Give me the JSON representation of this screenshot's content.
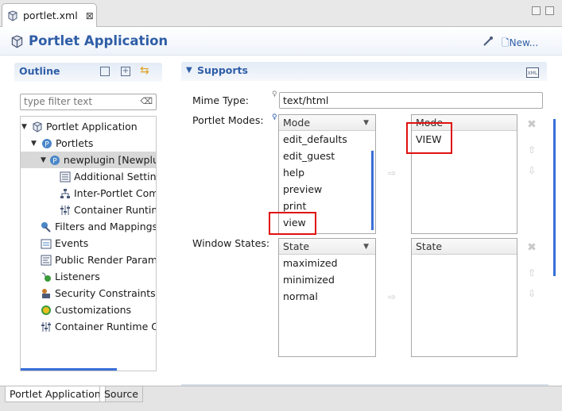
{
  "editor": {
    "tab_label": "portlet.xml",
    "close_glyph": "⊠",
    "form_title": "Portlet Application",
    "new_label": "New..."
  },
  "outline": {
    "title": "Outline",
    "filter_placeholder": "type filter text",
    "items": [
      {
        "label": "Portlet Application",
        "icon": "portlet-app-icon"
      },
      {
        "label": "Portlets",
        "icon": "portlets-icon"
      },
      {
        "label": "newplugin [Newplu",
        "icon": "portlet-icon"
      },
      {
        "label": "Additional Setting",
        "icon": "settings-icon"
      },
      {
        "label": "Inter-Portlet Com",
        "icon": "communication-icon"
      },
      {
        "label": "Container Runtim",
        "icon": "runtime-icon"
      },
      {
        "label": "Filters and Mappings",
        "icon": "filter-icon"
      },
      {
        "label": "Events",
        "icon": "events-icon"
      },
      {
        "label": "Public Render Parame",
        "icon": "render-param-icon"
      },
      {
        "label": "Listeners",
        "icon": "listener-icon"
      },
      {
        "label": "Security Constraints",
        "icon": "security-icon"
      },
      {
        "label": "Customizations",
        "icon": "customization-icon"
      },
      {
        "label": "Container Runtime Op",
        "icon": "runtime-icon"
      }
    ]
  },
  "supports": {
    "title": "Supports",
    "mime_label": "Mime Type:",
    "mime_value": "text/html",
    "modes_label": "Portlet Modes:",
    "modes_header": "Mode",
    "modes_available": [
      "edit_defaults",
      "edit_guest",
      "help",
      "preview",
      "print",
      "view"
    ],
    "modes_selected_header": "Mode",
    "modes_selected": [
      "VIEW"
    ],
    "states_label": "Window States:",
    "states_header": "State",
    "states_available": [
      "maximized",
      "minimized",
      "normal"
    ],
    "states_selected_header": "State",
    "states_selected": []
  },
  "bottom_tabs": [
    "Portlet Application",
    "Source"
  ],
  "colors": {
    "accent": "#2f5ea7",
    "highlight_box": "#e01010",
    "scroll": "#3a6fd8"
  }
}
